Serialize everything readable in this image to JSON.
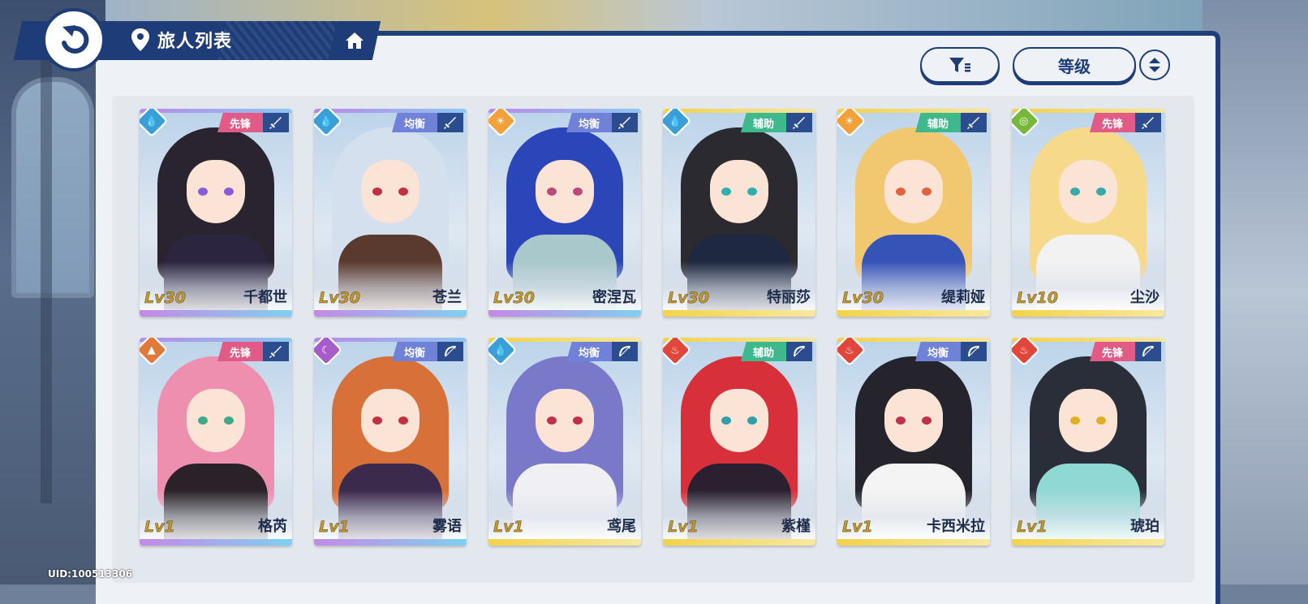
{
  "header": {
    "title": "旅人列表",
    "sort_label": "等级"
  },
  "uid": "UID:100513306",
  "colors": {
    "navy": "#1e3c78",
    "role_vanguard": "#e25a86",
    "role_balance": "#6f82d8",
    "role_support": "#3fb88d",
    "elem_water": "#3a9fd6",
    "elem_sun": "#f1a03a",
    "elem_wind": "#77b83a",
    "elem_earth": "#e07a3a",
    "elem_moon": "#a75cc9",
    "elem_fire": "#e0463a"
  },
  "characters": [
    {
      "name": "千都世",
      "level": "Lv30",
      "role": "先锋",
      "role_color": "#e25a86",
      "element": "water-icon",
      "weapon": "sword-icon",
      "frame": "purple",
      "hair": "#2a2430",
      "eye": "#8a5bd6",
      "outfit": "#2c2540"
    },
    {
      "name": "苍兰",
      "level": "Lv30",
      "role": "均衡",
      "role_color": "#6f82d8",
      "element": "water-icon",
      "weapon": "sword-icon",
      "frame": "purple",
      "hair": "#d5e0ee",
      "eye": "#c03040",
      "outfit": "#5a3a2e"
    },
    {
      "name": "密涅瓦",
      "level": "Lv30",
      "role": "均衡",
      "role_color": "#6f82d8",
      "element": "sun-icon",
      "weapon": "sword-icon",
      "frame": "purple",
      "hair": "#2a46b8",
      "eye": "#c04878",
      "outfit": "#a9c8cc"
    },
    {
      "name": "特丽莎",
      "level": "Lv30",
      "role": "辅助",
      "role_color": "#3fb88d",
      "element": "water-icon",
      "weapon": "sword-icon",
      "frame": "gold",
      "hair": "#2a2a30",
      "eye": "#2fb0b0",
      "outfit": "#1e2840"
    },
    {
      "name": "缇莉娅",
      "level": "Lv30",
      "role": "辅助",
      "role_color": "#3fb88d",
      "element": "sun-icon",
      "weapon": "sword-icon",
      "frame": "gold",
      "hair": "#f1c870",
      "eye": "#e06040",
      "outfit": "#3654b8"
    },
    {
      "name": "尘沙",
      "level": "Lv10",
      "role": "先锋",
      "role_color": "#e25a86",
      "element": "wind-icon",
      "weapon": "sword-icon",
      "frame": "gold",
      "hair": "#f6d98a",
      "eye": "#38a8a8",
      "outfit": "#f2f2f2"
    },
    {
      "name": "格芮",
      "level": "Lv1",
      "role": "先锋",
      "role_color": "#e25a86",
      "element": "earth-icon",
      "weapon": "sword-icon",
      "frame": "purple",
      "hair": "#ef8fb0",
      "eye": "#3fa88a",
      "outfit": "#2a2228"
    },
    {
      "name": "雾语",
      "level": "Lv1",
      "role": "均衡",
      "role_color": "#6f82d8",
      "element": "moon-icon",
      "weapon": "bow-icon",
      "frame": "purple",
      "hair": "#d8703a",
      "eye": "#c03040",
      "outfit": "#3c2a4c"
    },
    {
      "name": "鸢尾",
      "level": "Lv1",
      "role": "均衡",
      "role_color": "#6f82d8",
      "element": "water-icon",
      "weapon": "bow-icon",
      "frame": "gold",
      "hair": "#7a78c8",
      "eye": "#c03048",
      "outfit": "#f0f0f4"
    },
    {
      "name": "紫槿",
      "level": "Lv1",
      "role": "辅助",
      "role_color": "#3fb88d",
      "element": "fire-icon",
      "weapon": "bow-icon",
      "frame": "gold",
      "hair": "#d8303a",
      "eye": "#30a0a8",
      "outfit": "#2a2030"
    },
    {
      "name": "卡西米拉",
      "level": "Lv1",
      "role": "均衡",
      "role_color": "#6f82d8",
      "element": "fire-icon",
      "weapon": "bow-icon",
      "frame": "gold",
      "hair": "#25232c",
      "eye": "#c03048",
      "outfit": "#f4f4f4"
    },
    {
      "name": "琥珀",
      "level": "Lv1",
      "role": "先锋",
      "role_color": "#e25a86",
      "element": "fire-icon",
      "weapon": "bow-icon",
      "frame": "gold",
      "hair": "#2a2e38",
      "eye": "#e0b020",
      "outfit": "#8fd8d4"
    }
  ]
}
